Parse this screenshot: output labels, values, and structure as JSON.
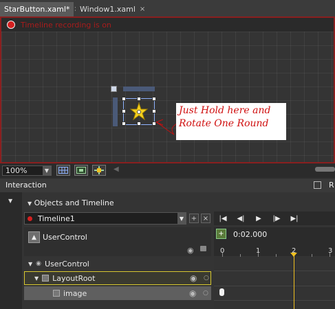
{
  "tabs": [
    {
      "label": "StarButton.xaml*",
      "close": "×"
    },
    {
      "label": "Window1.xaml",
      "close": "×"
    }
  ],
  "artboard": {
    "recording_text": "Timeline recording is on",
    "callout_line1": "Just Hold here and",
    "callout_line2": "Rotate One Round"
  },
  "zoom": {
    "value": "100%"
  },
  "interaction": {
    "title": "Interaction",
    "right_tab": "R"
  },
  "objects": {
    "title": "Objects and Timeline",
    "timeline_name": "Timeline1",
    "root_title": "UserControl",
    "time": "0:02.000",
    "ruler": [
      "0",
      "1",
      "2",
      "3"
    ],
    "tree": [
      {
        "label": "UserControl"
      },
      {
        "label": "LayoutRoot"
      },
      {
        "label": "image"
      }
    ]
  },
  "colors": {
    "recording": "#d42020",
    "playhead": "#f0c020",
    "selection": "#d8c830"
  }
}
